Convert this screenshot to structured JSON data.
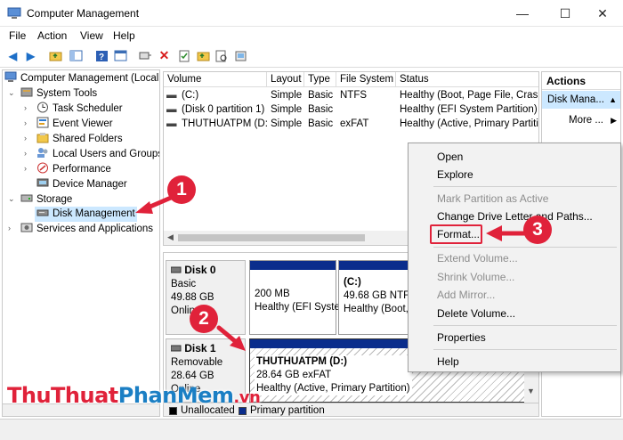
{
  "window": {
    "title": "Computer Management",
    "minimize": "—",
    "maximize": "☐",
    "close": "✕"
  },
  "menu": [
    "File",
    "Action",
    "View",
    "Help"
  ],
  "toolbar_icons": [
    "back-arrow-icon",
    "forward-arrow-icon",
    "up-folder-icon",
    "show-hide-tree-icon",
    "help-icon",
    "console-icon",
    "connect-icon",
    "delete-icon",
    "properties-icon",
    "folder-icon",
    "search-icon",
    "refresh-icon"
  ],
  "tree": {
    "items": [
      {
        "label": "Computer Management (Local",
        "arrow": "",
        "indent": 0,
        "icon": "computer-icon"
      },
      {
        "label": "System Tools",
        "arrow": "v",
        "indent": 1,
        "icon": "tools-icon"
      },
      {
        "label": "Task Scheduler",
        "arrow": ">",
        "indent": 2,
        "icon": "clock-icon"
      },
      {
        "label": "Event Viewer",
        "arrow": ">",
        "indent": 2,
        "icon": "event-icon"
      },
      {
        "label": "Shared Folders",
        "arrow": ">",
        "indent": 2,
        "icon": "shared-folder-icon"
      },
      {
        "label": "Local Users and Groups",
        "arrow": ">",
        "indent": 2,
        "icon": "users-icon"
      },
      {
        "label": "Performance",
        "arrow": ">",
        "indent": 2,
        "icon": "performance-icon"
      },
      {
        "label": "Device Manager",
        "arrow": "",
        "indent": 2,
        "icon": "device-manager-icon"
      },
      {
        "label": "Storage",
        "arrow": "v",
        "indent": 1,
        "icon": "storage-icon"
      },
      {
        "label": "Disk Management",
        "arrow": "",
        "indent": 2,
        "icon": "disk-icon"
      },
      {
        "label": "Services and Applications",
        "arrow": ">",
        "indent": 1,
        "icon": "services-icon"
      }
    ]
  },
  "volumes": {
    "headers": [
      "Volume",
      "Layout",
      "Type",
      "File System",
      "Status"
    ],
    "rows": [
      [
        "(C:)",
        "Simple",
        "Basic",
        "NTFS",
        "Healthy (Boot, Page File, Crash"
      ],
      [
        "(Disk 0 partition 1)",
        "Simple",
        "Basic",
        "",
        "Healthy (EFI System Partition)"
      ],
      [
        "THUTHUATPM (D:)",
        "Simple",
        "Basic",
        "exFAT",
        "Healthy (Active, Primary Partitio"
      ]
    ]
  },
  "disks": {
    "disk0": {
      "name": "Disk 0",
      "kind": "Basic",
      "size": "49.88 GB",
      "state": "Online",
      "parts": [
        {
          "l1": "200 MB",
          "l2": "Healthy (EFI Syste"
        },
        {
          "l0": "(C:)",
          "l1": "49.68 GB NTFS",
          "l2": "Healthy (Boot,"
        }
      ]
    },
    "disk1": {
      "name": "Disk 1",
      "kind": "Removable",
      "size": "28.64 GB",
      "state": "Online",
      "part": {
        "l0": "THUTHUATPM  (D:)",
        "l1": "28.64 GB exFAT",
        "l2": "Healthy (Active, Primary Partition)"
      }
    },
    "legend": [
      "Unallocated",
      "Primary partition"
    ]
  },
  "actions": {
    "header": "Actions",
    "selected": "Disk Mana...",
    "more": "More ..."
  },
  "context_menu": {
    "items": [
      {
        "label": "Open",
        "enabled": true
      },
      {
        "label": "Explore",
        "enabled": true
      },
      {
        "label": "Mark Partition as Active",
        "enabled": false
      },
      {
        "label": "Change Drive Letter and Paths...",
        "enabled": true
      },
      {
        "label": "Format...",
        "enabled": true
      },
      {
        "label": "Extend Volume...",
        "enabled": false
      },
      {
        "label": "Shrink Volume...",
        "enabled": false
      },
      {
        "label": "Add Mirror...",
        "enabled": false
      },
      {
        "label": "Delete Volume...",
        "enabled": true
      },
      {
        "label": "Properties",
        "enabled": true
      },
      {
        "label": "Help",
        "enabled": true
      }
    ]
  },
  "annotations": {
    "step1": "1",
    "step2": "2",
    "step3": "3",
    "color": "#e0223a"
  },
  "watermark": {
    "part1": "ThuThuat",
    "part2": "PhanMem",
    "part3": ".vn"
  }
}
